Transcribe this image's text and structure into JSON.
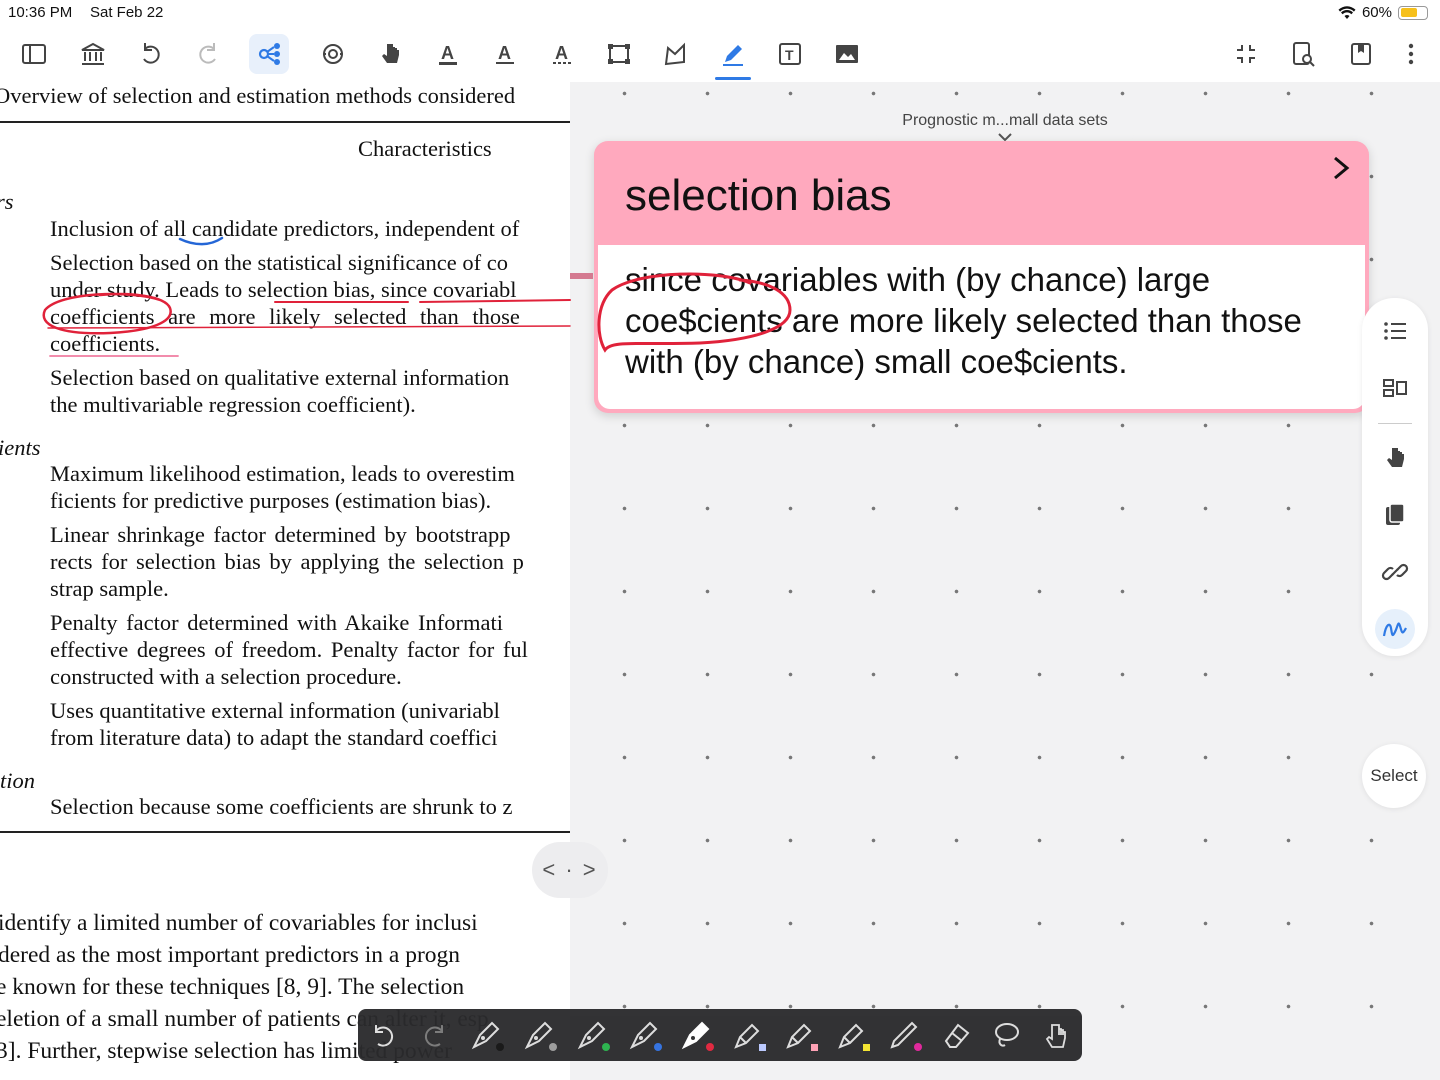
{
  "status": {
    "time": "10:36 PM",
    "date": "Sat Feb 22",
    "battery": "60%",
    "battery_level": 0.6
  },
  "toolbar": {
    "left_icons": [
      "sidebar-icon",
      "library-icon",
      "undo-icon",
      "redo-icon",
      "mindmap-icon",
      "sync-icon",
      "hand-icon",
      "text-highlight-icon",
      "text-underline-icon",
      "text-strike-icon",
      "crop-icon",
      "shape-icon",
      "pen-icon",
      "textbox-icon",
      "image-icon"
    ],
    "right_icons": [
      "collapse-icon",
      "search-doc-icon",
      "bookmark-icon",
      "more-icon"
    ]
  },
  "pdf": {
    "lines": [
      {
        "text": "Overview of selection and estimation methods considered",
        "cls": ""
      },
      {
        "text": "Characteristics",
        "cls": ""
      },
      {
        "text": "rs",
        "cls": "it"
      },
      {
        "text": "Inclusion of all candidate predictors, independent of",
        "cls": ""
      },
      {
        "text": "Selection based on the statistical significance of co",
        "cls": ""
      },
      {
        "text": "under study. Leads to selection bias, since covariabl",
        "cls": ""
      },
      {
        "text": "coefficients are more likely selected than those",
        "cls": ""
      },
      {
        "text": "coefficients.",
        "cls": ""
      },
      {
        "text": "Selection based on qualitative external information",
        "cls": ""
      },
      {
        "text": "the multivariable regression coefficient).",
        "cls": ""
      },
      {
        "text": "ients",
        "cls": "it"
      },
      {
        "text": "Maximum likelihood estimation, leads to overestim",
        "cls": ""
      },
      {
        "text": "ficients for predictive purposes (estimation bias).",
        "cls": ""
      },
      {
        "text": "Linear shrinkage factor determined by bootstrapp",
        "cls": ""
      },
      {
        "text": "rects for selection bias by applying the selection p",
        "cls": ""
      },
      {
        "text": "strap sample.",
        "cls": ""
      },
      {
        "text": "Penalty factor determined with Akaike Informati",
        "cls": ""
      },
      {
        "text": "effective degrees of freedom. Penalty factor for ful",
        "cls": ""
      },
      {
        "text": "constructed with a selection procedure.",
        "cls": ""
      },
      {
        "text": "Uses quantitative external information (univariabl",
        "cls": ""
      },
      {
        "text": "from literature data) to adapt the standard coeffici",
        "cls": ""
      },
      {
        "text": "tion",
        "cls": "it"
      },
      {
        "text": "Selection because some coefficients are shrunk to z",
        "cls": ""
      },
      {
        "text": "identify a limited number of covariables for inclusi",
        "cls": ""
      },
      {
        "text": "dered as the most important predictors in a progn",
        "cls": ""
      },
      {
        "text": "e known for these techniques [8, 9]. The selection",
        "cls": ""
      },
      {
        "text": "eletion of a small number of patients can alter it, esp",
        "cls": ""
      },
      {
        "text": "3]. Further, stepwise selection has limited power",
        "cls": ""
      }
    ]
  },
  "notes": {
    "breadcrumb": "Prognostic m...mall data sets",
    "card": {
      "title": "selection bias",
      "body": "since covariables with (by chance) large coe$cients are more likely selected than those with (by chance) small coe$cients."
    },
    "sidebar_icons": [
      "outline-icon",
      "layout-icon",
      "hand-icon",
      "copy-icon",
      "link-icon",
      "ink-icon"
    ],
    "select_label": "Select",
    "splitter_label": "< · >"
  },
  "pen_tools": {
    "items": [
      {
        "icon": "undo-icon",
        "color": ""
      },
      {
        "icon": "redo-icon",
        "color": ""
      },
      {
        "icon": "fountain-pen-icon",
        "color": "#111111"
      },
      {
        "icon": "fountain-pen-icon",
        "color": "#9a9a9a"
      },
      {
        "icon": "fountain-pen-icon",
        "color": "#27b24a"
      },
      {
        "icon": "fountain-pen-icon",
        "color": "#2f6fe0"
      },
      {
        "icon": "fountain-pen-icon",
        "color": "#e0223a"
      },
      {
        "icon": "highlighter-icon",
        "color": "#b9c8ff"
      },
      {
        "icon": "highlighter-icon",
        "color": "#ff9fb4"
      },
      {
        "icon": "highlighter-icon",
        "color": "#f5e52c"
      },
      {
        "icon": "marker-icon",
        "color": "#e0219a"
      },
      {
        "icon": "eraser-icon",
        "color": ""
      },
      {
        "icon": "lasso-icon",
        "color": ""
      },
      {
        "icon": "touch-icon",
        "color": ""
      }
    ]
  }
}
